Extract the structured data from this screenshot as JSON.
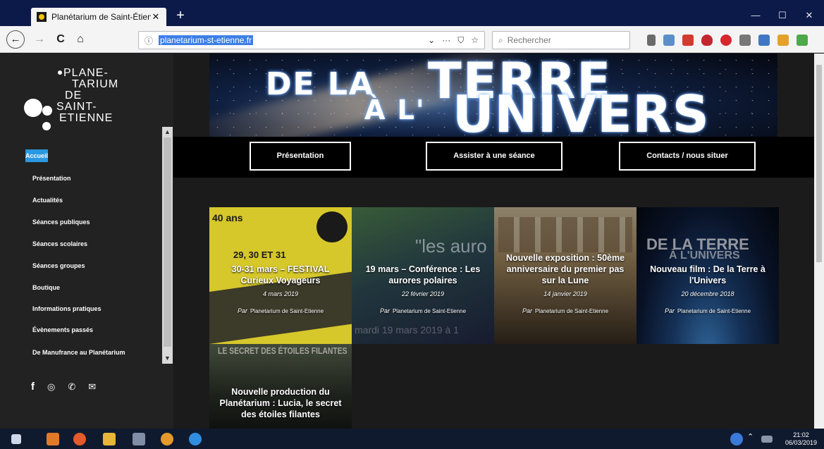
{
  "browser": {
    "tab_title": "Planétarium de Saint-Étienne – ",
    "tab_close": "✕",
    "new_tab": "+",
    "window_buttons": [
      "—",
      "☐",
      "✕"
    ],
    "url": "planetarium-st-etienne.fr",
    "url_info_icon": "ⓘ",
    "url_actions": [
      "⌄",
      "···",
      "⛉",
      "☆"
    ],
    "search_placeholder": "Rechercher",
    "nav_icons": [
      "←",
      "→",
      "C",
      "⌂"
    ]
  },
  "sidebar": {
    "logo_lines": [
      "PLANE-",
      "TARIUM",
      "DE",
      "SAINT-",
      "ETIENNE"
    ],
    "active_item": "Accueil",
    "items": [
      "Présentation",
      "Actualités",
      "Séances publiques",
      "Séances scolaires",
      "Séances groupes",
      "Boutique",
      "Informations pratiques",
      "Évènements passés",
      "De Manufrance au Planétarium"
    ],
    "social_icons": [
      "f",
      "◎",
      "✆",
      "✉"
    ]
  },
  "banner": {
    "line1": "DE LA",
    "line2": "TERRE",
    "line3": "À L'",
    "line4": "UNIVERS"
  },
  "menu": [
    "Présentation",
    "Assister à une séance",
    "Contacts / nous situer"
  ],
  "cards": [
    {
      "title": "30-31 mars – FESTIVAL Curieux Voyageurs",
      "date": "4 mars 2019",
      "by": "Par",
      "author": "Planetarium de Saint-Etienne",
      "bg_text": "29, 30 ET 31",
      "bg_text2": "40 ans",
      "colors": [
        "#d7c92c",
        "#b5a71d"
      ]
    },
    {
      "title": "19 mars – Conférence : Les aurores polaires",
      "date": "22 février 2019",
      "by": "Par",
      "author": "Planetarium de Saint-Etienne",
      "bg_text": "\"les auro",
      "bg_text2": "mardi 19 mars 2019 à 1",
      "colors": [
        "#3a5f3e",
        "#2b3554"
      ]
    },
    {
      "title": "Nouvelle exposition : 50ème anniversaire du premier pas sur la Lune",
      "date": "14 janvier 2019",
      "by": "Par",
      "author": "Planetarium de Saint-Etienne",
      "colors": [
        "#c9b38a",
        "#8a6f4a"
      ]
    },
    {
      "title": "Nouveau film : De la Terre à l'Univers",
      "date": "20 décembre 2018",
      "by": "Par",
      "author": "Planetarium de Saint-Etienne",
      "bg_text": "DE LA TERRE",
      "bg_text2": "À L'UNIVERS",
      "colors": [
        "#1f3d6a",
        "#0a1428"
      ]
    },
    {
      "title": "Nouvelle production du Planétarium : Lucia, le secret des étoiles filantes",
      "bg_text": "LE SECRET DES ÉTOILES FILANTES",
      "colors": [
        "#4a5a4a",
        "#1d2420"
      ]
    }
  ],
  "taskbar": {
    "time": "21:02",
    "date": "06/03/2019"
  }
}
